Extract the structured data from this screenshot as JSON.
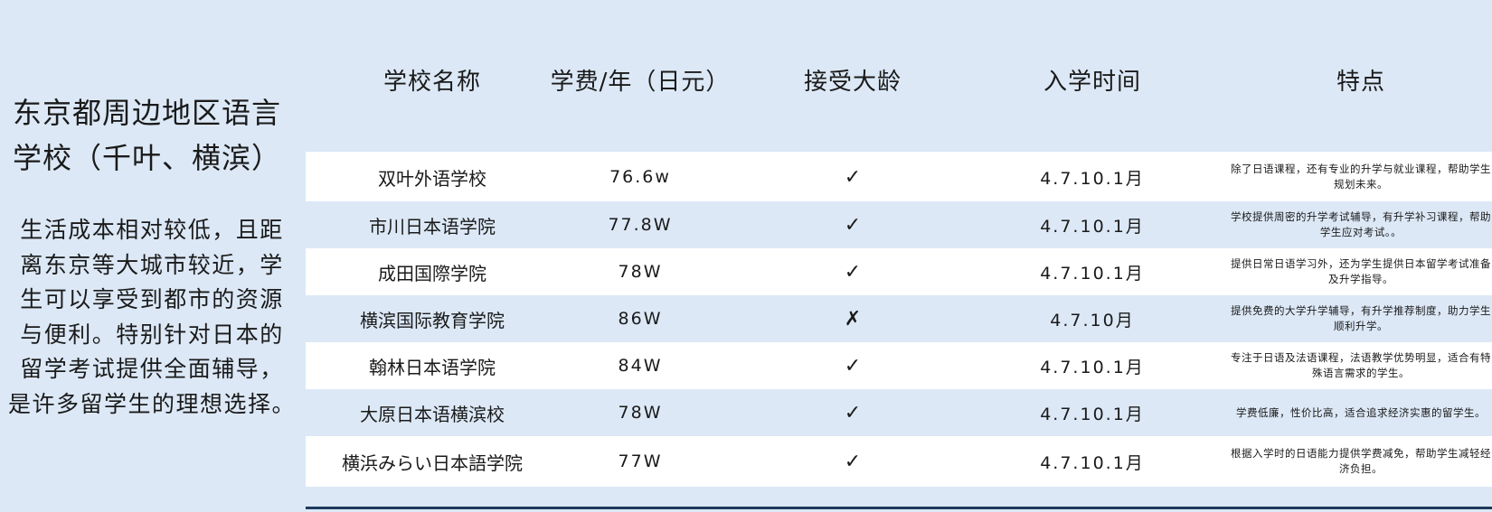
{
  "side": {
    "title_line1": "东京都周边地区语言",
    "title_line2": "学校（千叶、横滨）",
    "desc_lines": [
      "生活成本相对较低，且距",
      "离东京等大城市较近，学",
      "生可以享受到都市的资源",
      "与便利。特别针对日本的",
      "留学考试提供全面辅导，",
      "是许多留学生的理想选择。"
    ]
  },
  "table": {
    "headers": {
      "name": "学校名称",
      "fee": "学费/年（日元）",
      "age": "接受大龄",
      "time": "入学时间",
      "feature": "特点"
    },
    "rows": [
      {
        "name": "双叶外语学校",
        "fee": "76.6w",
        "age": "✓",
        "time": "4.7.10.1月",
        "feature": "除了日语课程，还有专业的升学与就业课程，帮助学生规划未来。"
      },
      {
        "name": "市川日本语学院",
        "fee": "77.8W",
        "age": "✓",
        "time": "4.7.10.1月",
        "feature": "学校提供周密的升学考试辅导，有升学补习课程，帮助学生应对考试。。"
      },
      {
        "name": "成田国際学院",
        "fee": "78W",
        "age": "✓",
        "time": "4.7.10.1月",
        "feature": "提供日常日语学习外，还为学生提供日本留学考试准备及升学指导。"
      },
      {
        "name": "横滨国际教育学院",
        "fee": "86W",
        "age": "✗",
        "time": "4.7.10月",
        "feature": "提供免费的大学升学辅导，有升学推荐制度，助力学生顺利升学。"
      },
      {
        "name": "翰林日本语学院",
        "fee": "84W",
        "age": "✓",
        "time": "4.7.10.1月",
        "feature": "专注于日语及法语课程，法语教学优势明显，适合有特殊语言需求的学生。"
      },
      {
        "name": "大原日本语横滨校",
        "fee": "78W",
        "age": "✓",
        "time": "4.7.10.1月",
        "feature": "学费低廉，性价比高，适合追求经济实惠的留学生。"
      },
      {
        "name": "横浜みらい日本語学院",
        "fee": "77W",
        "age": "✓",
        "time": "4.7.10.1月",
        "feature": "根据入学时的日语能力提供学费减免，帮助学生减轻经济负担。"
      }
    ]
  }
}
